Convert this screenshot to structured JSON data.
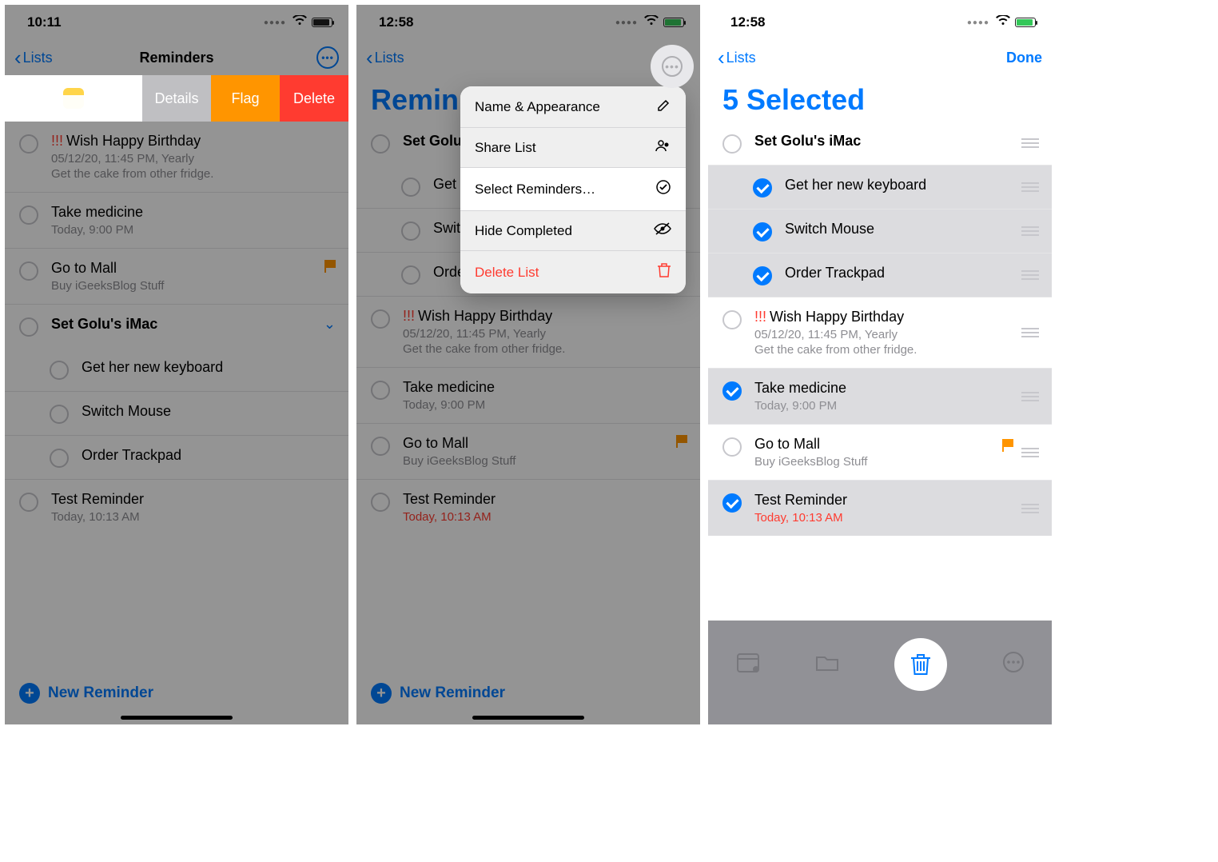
{
  "panel1": {
    "time": "10:11",
    "back_label": "Lists",
    "title": "Reminders",
    "swipe": {
      "details": "Details",
      "flag": "Flag",
      "delete": "Delete"
    },
    "rows": [
      {
        "priority": "!!!",
        "title": "Wish Happy Birthday",
        "sub": "05/12/20, 11:45 PM, Yearly",
        "sub2": "Get the cake from other fridge."
      },
      {
        "title": "Take medicine",
        "sub": "Today, 9:00 PM"
      },
      {
        "title": "Go to Mall",
        "sub": "Buy iGeeksBlog Stuff",
        "flag": true
      },
      {
        "title": "Set Golu's iMac",
        "bold": true,
        "expand": true
      },
      {
        "title": "Get her new keyboard",
        "sub_item": true
      },
      {
        "title": "Switch Mouse",
        "sub_item": true
      },
      {
        "title": "Order Trackpad",
        "sub_item": true
      },
      {
        "title": "Test Reminder",
        "sub": "Today, 10:13 AM"
      }
    ],
    "footer": "New Reminder"
  },
  "panel2": {
    "time": "12:58",
    "back_label": "Lists",
    "big_title": "Remin",
    "menu": {
      "name_appearance": "Name & Appearance",
      "share_list": "Share List",
      "select": "Select Reminders…",
      "hide_completed": "Hide Completed",
      "delete_list": "Delete List"
    },
    "rows": [
      {
        "title": "Set Golu",
        "bold": true
      },
      {
        "title": "Get",
        "sub_item": true
      },
      {
        "title": "Swit",
        "sub_item": true
      },
      {
        "title": "Order Trackpad",
        "sub_item": true
      },
      {
        "priority": "!!!",
        "title": "Wish Happy Birthday",
        "sub": "05/12/20, 11:45 PM, Yearly",
        "sub2": "Get the cake from other fridge."
      },
      {
        "title": "Take medicine",
        "sub": "Today, 9:00 PM"
      },
      {
        "title": "Go to Mall",
        "sub": "Buy iGeeksBlog Stuff",
        "flag": true
      },
      {
        "title": "Test Reminder",
        "sub": "Today, 10:13 AM",
        "sub_red": true
      }
    ],
    "footer": "New Reminder"
  },
  "panel3": {
    "time": "12:58",
    "back_label": "Lists",
    "done": "Done",
    "big_title": "5 Selected",
    "rows": [
      {
        "title": "Set Golu's iMac",
        "bold": true,
        "selected": false
      },
      {
        "title": "Get her new keyboard",
        "sub_item": true,
        "selected": true
      },
      {
        "title": "Switch Mouse",
        "sub_item": true,
        "selected": true
      },
      {
        "title": "Order Trackpad",
        "sub_item": true,
        "selected": true
      },
      {
        "priority": "!!!",
        "title": "Wish Happy Birthday",
        "sub": "05/12/20, 11:45 PM, Yearly",
        "sub2": "Get the cake from other fridge.",
        "selected": false
      },
      {
        "title": "Take medicine",
        "sub": "Today, 9:00 PM",
        "selected": true
      },
      {
        "title": "Go to Mall",
        "sub": "Buy iGeeksBlog Stuff",
        "flag": true,
        "selected": false
      },
      {
        "title": "Test Reminder",
        "sub": "Today, 10:13 AM",
        "sub_red": true,
        "selected": true
      }
    ]
  }
}
